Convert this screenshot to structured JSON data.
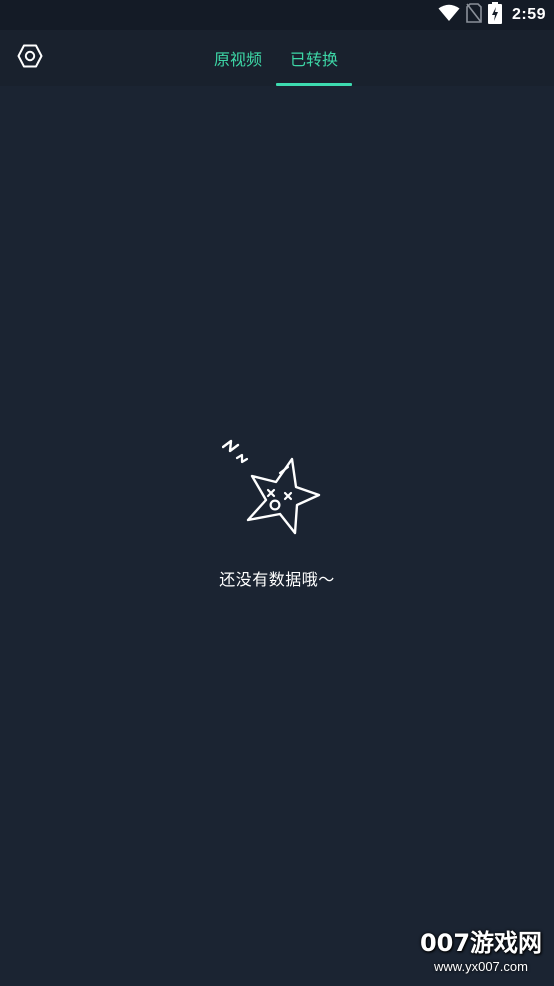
{
  "status_bar": {
    "time": "2:59",
    "icons": [
      "wifi-icon",
      "no-sim-icon",
      "battery-charging-icon"
    ]
  },
  "header": {
    "settings_icon": "settings-hex-icon",
    "tabs": [
      {
        "label": "原视频",
        "active": false
      },
      {
        "label": "已转换",
        "active": true
      }
    ]
  },
  "empty_state": {
    "icon": "sleeping-star-icon",
    "message": "还没有数据哦～"
  },
  "watermark": {
    "brand": "007游戏网",
    "url": "www.yx007.com"
  },
  "colors": {
    "background": "#1b2432",
    "header": "#19212d",
    "accent": "#3ddbb0",
    "text": "#ffffff"
  }
}
